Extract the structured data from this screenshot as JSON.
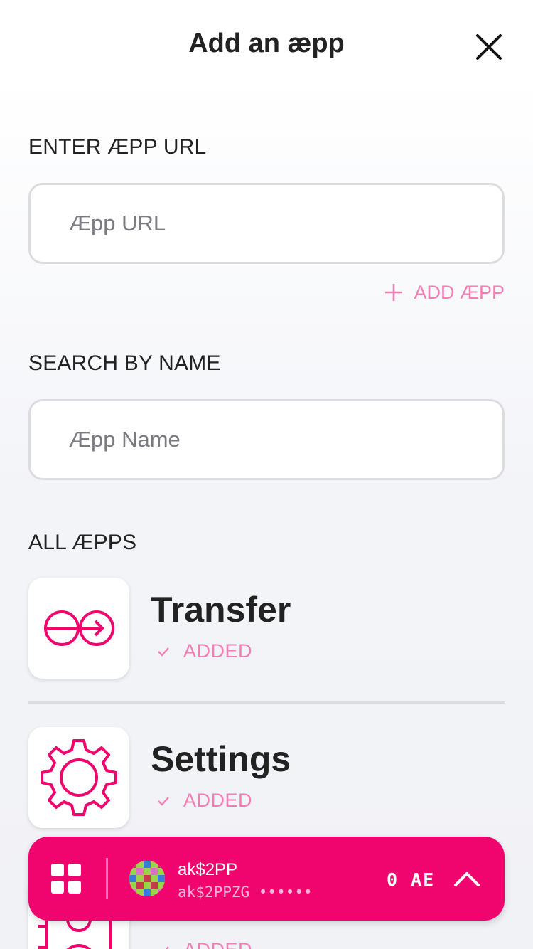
{
  "header": {
    "title": "Add an æpp",
    "close_icon": "close-icon"
  },
  "url_section": {
    "label": "ENTER ÆPP URL",
    "input_value": "",
    "input_placeholder": "Æpp URL",
    "add_button_label": "ADD ÆPP",
    "add_icon": "plus-icon"
  },
  "search_section": {
    "label": "SEARCH BY NAME",
    "input_value": "",
    "input_placeholder": "Æpp Name"
  },
  "apps_section": {
    "label": "ALL ÆPPS",
    "apps": [
      {
        "name": "Transfer",
        "status": "ADDED",
        "icon": "transfer-icon"
      },
      {
        "name": "Settings",
        "status": "ADDED",
        "icon": "gear-icon"
      },
      {
        "name": "",
        "status": "ADDED",
        "icon": "address-book-icon"
      }
    ]
  },
  "account_bar": {
    "grid_icon": "grid-icon",
    "account_name": "ak$2PP",
    "account_address": "ak$2PPZG ••••••",
    "balance": "0 AE",
    "expand_icon": "chevron-up-icon"
  },
  "colors": {
    "accent": "#f0056f",
    "accent_light": "#f37eb6",
    "text": "#222222",
    "border": "#dcdce0"
  }
}
